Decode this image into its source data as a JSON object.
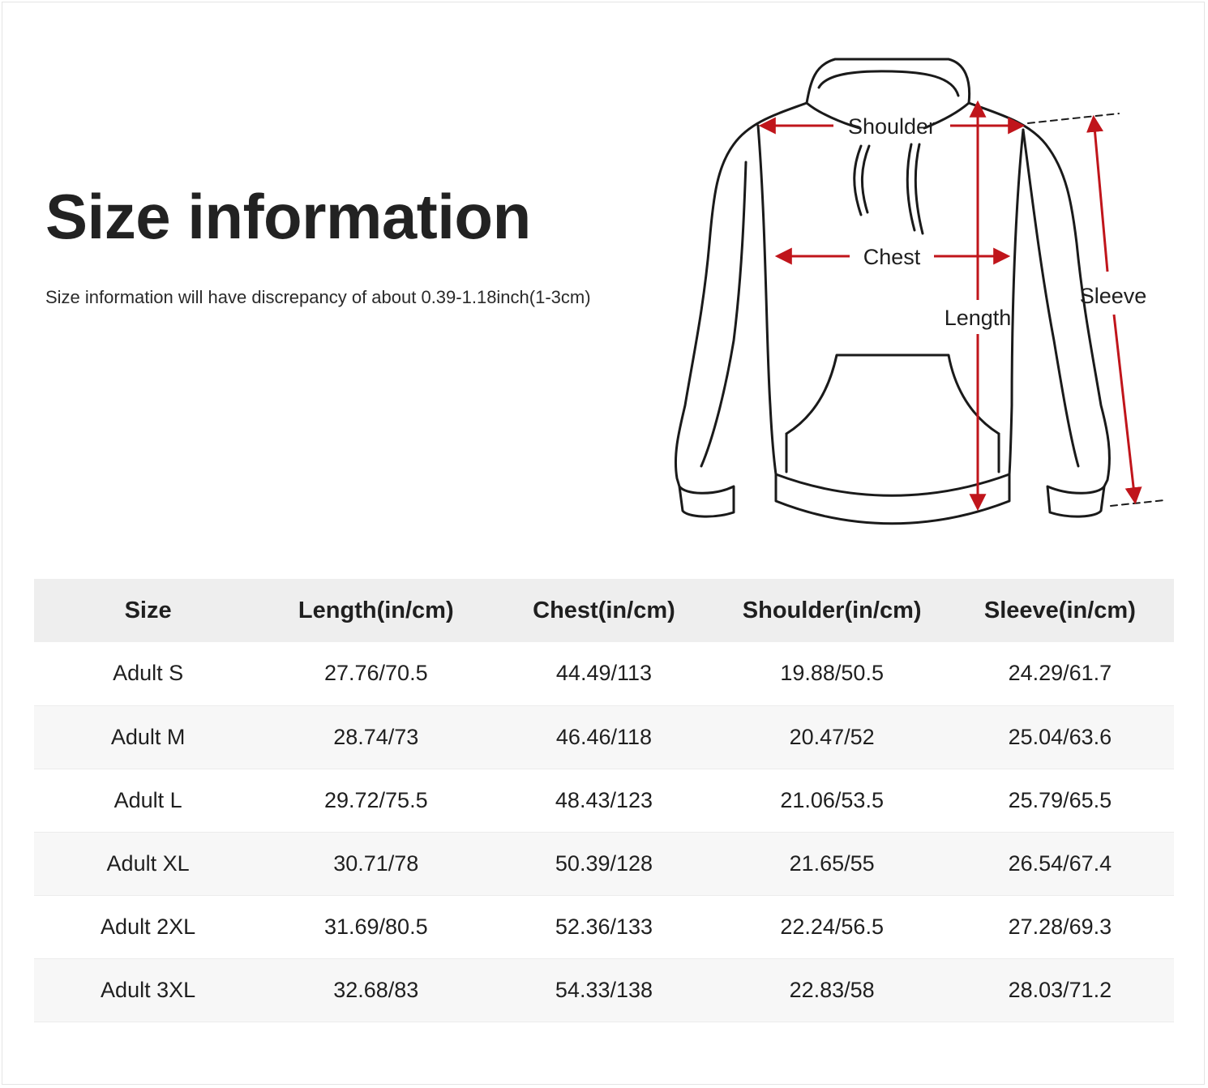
{
  "page": {
    "title": "Size information",
    "subtitle": "Size information will have discrepancy of about 0.39-1.18inch(1-3cm)"
  },
  "diagram": {
    "labels": {
      "shoulder": "Shoulder",
      "chest": "Chest",
      "length": "Length",
      "sleeve": "Sleeve"
    },
    "colors": {
      "outline": "#1a1a1a",
      "arrow": "#c0151b"
    }
  },
  "table": {
    "headers": [
      "Size",
      "Length(in/cm)",
      "Chest(in/cm)",
      "Shoulder(in/cm)",
      "Sleeve(in/cm)"
    ],
    "rows": [
      [
        "Adult S",
        "27.76/70.5",
        "44.49/113",
        "19.88/50.5",
        "24.29/61.7"
      ],
      [
        "Adult M",
        "28.74/73",
        "46.46/118",
        "20.47/52",
        "25.04/63.6"
      ],
      [
        "Adult L",
        "29.72/75.5",
        "48.43/123",
        "21.06/53.5",
        "25.79/65.5"
      ],
      [
        "Adult XL",
        "30.71/78",
        "50.39/128",
        "21.65/55",
        "26.54/67.4"
      ],
      [
        "Adult 2XL",
        "31.69/80.5",
        "52.36/133",
        "22.24/56.5",
        "27.28/69.3"
      ],
      [
        "Adult 3XL",
        "32.68/83",
        "54.33/138",
        "22.83/58",
        "28.03/71.2"
      ]
    ],
    "colors": {
      "header_bg": "#eeeeee",
      "alt_row_bg": "#f7f7f7"
    }
  }
}
